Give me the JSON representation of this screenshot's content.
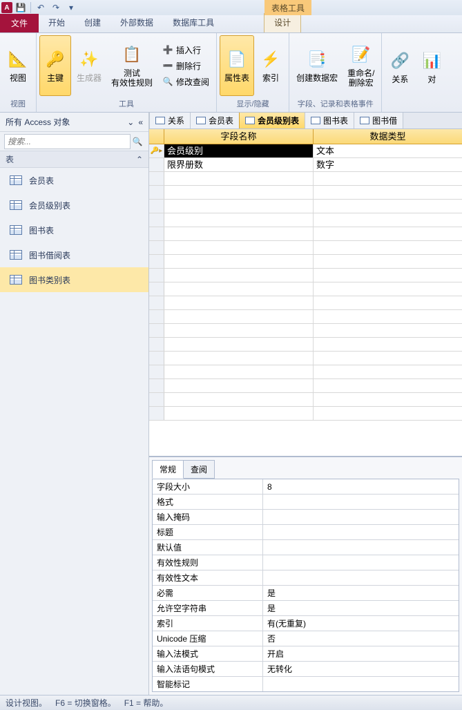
{
  "qat": {
    "app_letter": "A"
  },
  "context_tab": "表格工具",
  "tabs": {
    "file": "文件",
    "start": "开始",
    "create": "创建",
    "external": "外部数据",
    "dbtools": "数据库工具",
    "design": "设计"
  },
  "ribbon": {
    "view": {
      "label": "视图",
      "group": "视图"
    },
    "pk": {
      "label": "主键"
    },
    "builder": {
      "label": "生成器"
    },
    "test": {
      "label": "测试\n有效性规则",
      "group": "工具"
    },
    "insert_row": "插入行",
    "delete_row": "删除行",
    "modify_lookup": "修改查阅",
    "propsheet": {
      "label": "属性表"
    },
    "index": {
      "label": "索引",
      "group": "显示/隐藏"
    },
    "datamacro": {
      "label": "创建数据宏"
    },
    "rename": {
      "label": "重命名/\n删除宏",
      "group": "字段、记录和表格事件"
    },
    "relation": {
      "label": "关系"
    },
    "objdep": {
      "label": "对"
    }
  },
  "nav": {
    "title": "所有 Access 对象",
    "search_placeholder": "搜索...",
    "section": "表",
    "items": [
      {
        "label": "会员表"
      },
      {
        "label": "会员级别表"
      },
      {
        "label": "图书表"
      },
      {
        "label": "图书借阅表"
      },
      {
        "label": "图书类别表"
      }
    ]
  },
  "doctabs": [
    {
      "label": "关系"
    },
    {
      "label": "会员表"
    },
    {
      "label": "会员级别表"
    },
    {
      "label": "图书表"
    },
    {
      "label": "图书借"
    }
  ],
  "grid": {
    "col_field": "字段名称",
    "col_type": "数据类型",
    "rows": [
      {
        "name": "会员级别",
        "type": "文本",
        "pk": true,
        "sel": true
      },
      {
        "name": "限界册数",
        "type": "数字"
      }
    ]
  },
  "prop_tabs": {
    "general": "常规",
    "lookup": "查阅"
  },
  "props": [
    {
      "n": "字段大小",
      "v": "8"
    },
    {
      "n": "格式",
      "v": ""
    },
    {
      "n": "输入掩码",
      "v": ""
    },
    {
      "n": "标题",
      "v": ""
    },
    {
      "n": "默认值",
      "v": ""
    },
    {
      "n": "有效性规则",
      "v": ""
    },
    {
      "n": "有效性文本",
      "v": ""
    },
    {
      "n": "必需",
      "v": "是"
    },
    {
      "n": "允许空字符串",
      "v": "是"
    },
    {
      "n": "索引",
      "v": "有(无重复)"
    },
    {
      "n": "Unicode 压缩",
      "v": "否"
    },
    {
      "n": "输入法模式",
      "v": "开启"
    },
    {
      "n": "输入法语句模式",
      "v": "无转化"
    },
    {
      "n": "智能标记",
      "v": ""
    }
  ],
  "status": {
    "a": "设计视图。",
    "b": "F6 = 切换窗格。",
    "c": "F1 = 帮助。"
  }
}
